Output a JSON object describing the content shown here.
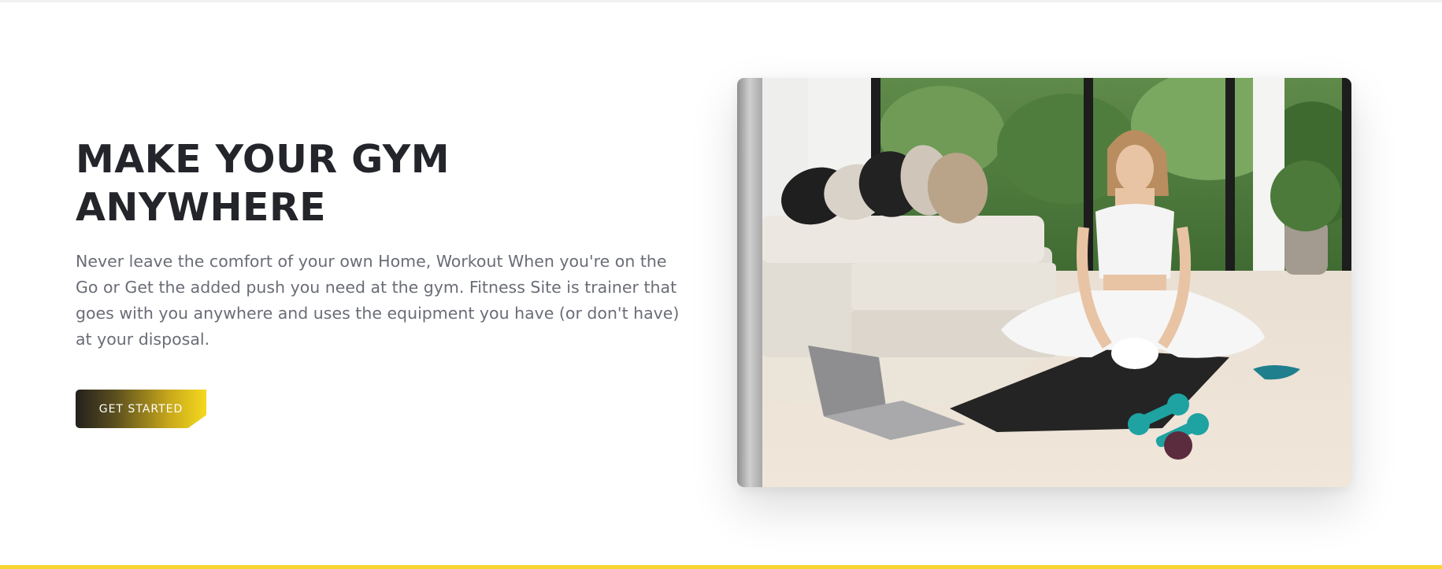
{
  "hero": {
    "title_line1": "MAKE YOUR GYM",
    "title_line2": "ANYWHERE",
    "description": "Never leave the comfort of your own Home, Workout When you're on the Go or Get the added push you need at the gym. Fitness Site is trainer that goes with you anywhere and uses the equipment you have (or don't have) at your disposal.",
    "cta_label": "GET STARTED"
  },
  "colors": {
    "accent": "#f7d631",
    "heading": "#23252b",
    "body_text": "#6a6d76"
  },
  "image": {
    "subject": "woman-stretching-on-yoga-mat-in-living-room"
  }
}
